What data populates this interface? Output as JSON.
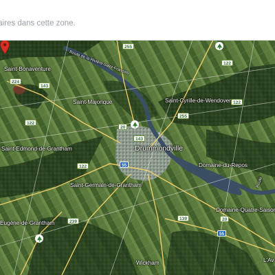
{
  "search": {
    "placeholder_text": "taires dans cette zone."
  },
  "places": {
    "saint_bonaventure": "Saint-Bonaventure",
    "saint_majorique": "Saint-Majorique",
    "saint_cyrille": "Saint-Cyrille-de-Wendover",
    "drummondville": "Drummondville",
    "saint_edmond": "Saint-Edmond-de-Grantham",
    "domaine_repos": "Domaine-du-Repos",
    "saint_germain": "Saint-Germain-de-Grantham",
    "domaine_quatre": "Domaine-Quatre-Saisons",
    "saint_eugene": "Eugène-de-Grantham",
    "wickham": "Wickham",
    "lav": "L'Av",
    "route_riviere": "Route de la Rivière-Saint-François",
    "route_east": "Route"
  },
  "routes": {
    "r255": "255",
    "r224": "224",
    "r143a": "143",
    "r122a": "122",
    "r143b": "143",
    "r122b": "122",
    "r20": "20",
    "r55": "55",
    "r122c": "122",
    "r122d": "122",
    "r255b": "255",
    "r139": "139",
    "r239": "239",
    "r55b": "55",
    "r20b": "20"
  },
  "colors": {
    "map_pin": "#d93025",
    "route_shield_border": "#6b8f3a",
    "highway_shield": "#1f63b5",
    "road_yellow": "#f3d36b",
    "river": "#3a4f63"
  },
  "icons": {
    "park": "park-tree-icon",
    "pin": "location-pin-icon"
  }
}
